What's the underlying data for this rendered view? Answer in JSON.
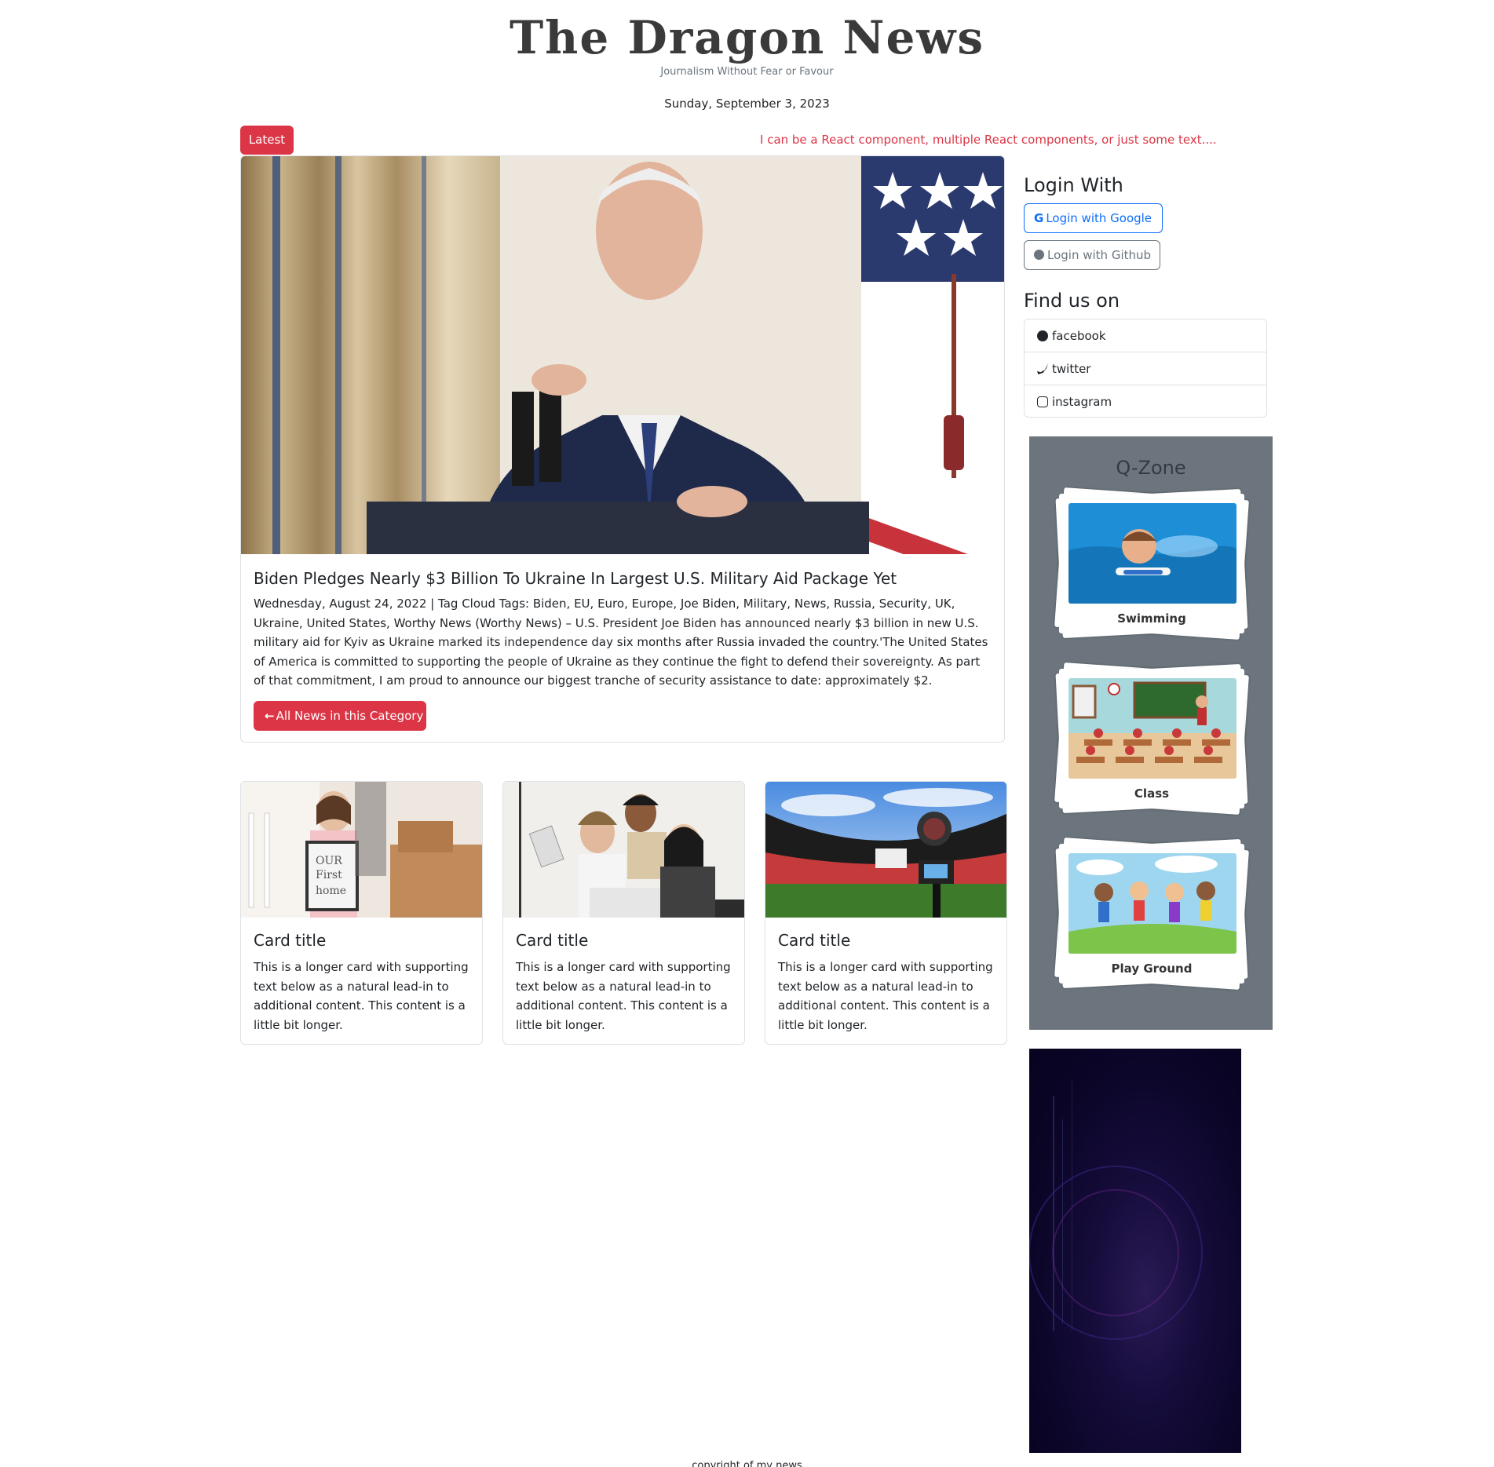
{
  "header": {
    "title": "The Dragon News",
    "tagline": "Journalism Without Fear or Favour",
    "date": "Sunday, September 3, 2023"
  },
  "ticker": {
    "badge": "Latest",
    "text": "I can be a React component, multiple React components, or just some text...."
  },
  "main_news": {
    "title": "Biden Pledges Nearly $3 Billion To Ukraine In Largest U.S. Military Aid Package Yet",
    "body": "Wednesday, August 24, 2022 | Tag Cloud Tags: Biden, EU, Euro, Europe, Joe Biden, Military, News, Russia, Security, UK, Ukraine, United States, Worthy News (Worthy News) – U.S. President Joe Biden has announced nearly $3 billion in new U.S. military aid for Kyiv as Ukraine marked its independence day six months after Russia invaded the country.'The United States of America is committed to supporting the people of Ukraine as they continue the fight to defend their sovereignty. As part of that commitment, I am proud to announce our biggest tranche of security assistance to date: approximately $2.",
    "button": "All News in this Category"
  },
  "cards": [
    {
      "title": "Card title",
      "text": "This is a longer card with supporting text below as a natural lead-in to additional content. This content is a little bit longer."
    },
    {
      "title": "Card title",
      "text": "This is a longer card with supporting text below as a natural lead-in to additional content. This content is a little bit longer."
    },
    {
      "title": "Card title",
      "text": "This is a longer card with supporting text below as a natural lead-in to additional content. This content is a little bit longer."
    }
  ],
  "sidebar": {
    "login_heading": "Login With",
    "google_btn": "Login with Google",
    "github_btn": "Login with Github",
    "find_heading": "Find us on",
    "social": [
      {
        "label": "facebook",
        "icon": "facebook-icon"
      },
      {
        "label": "twitter",
        "icon": "twitter-icon"
      },
      {
        "label": "instagram",
        "icon": "instagram-icon"
      }
    ],
    "qzone": {
      "title": "Q-Zone",
      "items": [
        {
          "label": "Swimming"
        },
        {
          "label": "Class"
        },
        {
          "label": "Play Ground"
        }
      ]
    }
  },
  "footer": {
    "text": "copyright of my news"
  },
  "colors": {
    "brand_red": "#dc3545",
    "primary_blue": "#0d6efd",
    "secondary_gray": "#6c757d"
  }
}
